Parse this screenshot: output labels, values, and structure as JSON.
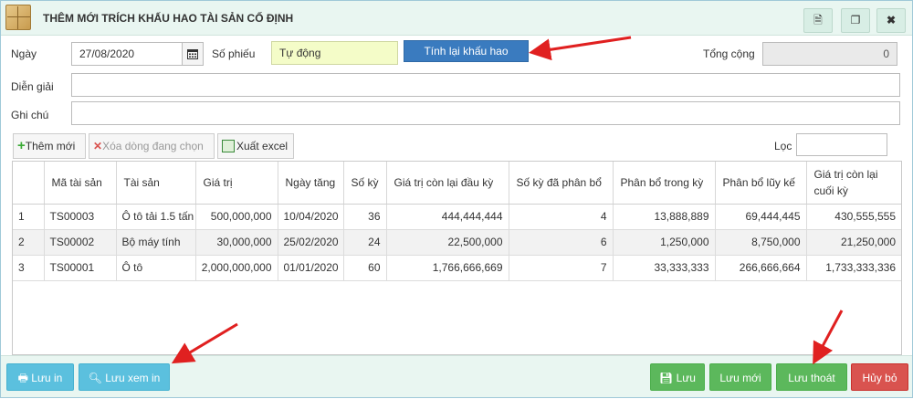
{
  "window": {
    "title": "THÊM MỚI TRÍCH KHẤU HAO TÀI SẢN CỐ ĐỊNH",
    "buttons": {
      "doc_icon": "document-icon",
      "copy_icon": "copy-icon",
      "close_icon": "close-icon"
    }
  },
  "form": {
    "date_label": "Ngày",
    "date_value": "27/08/2020",
    "voucher_label": "Số phiếu",
    "voucher_value": "Tự động",
    "recalc_button": "Tính lại khấu hao",
    "total_label": "Tổng cộng",
    "total_value": "0",
    "description_label": "Diễn giải",
    "description_value": "",
    "note_label": "Ghi chú",
    "note_value": ""
  },
  "toolbar": {
    "add_label": "Thêm mới",
    "delete_label": "Xóa dòng đang chọn",
    "export_label": "Xuất excel",
    "filter_label": "Lọc",
    "filter_value": ""
  },
  "table": {
    "headers": [
      "",
      "Mã tài sản",
      "Tài sản",
      "Giá trị",
      "Ngày tăng",
      "Số kỳ",
      "Giá trị còn lại đầu kỳ",
      "Số kỳ đã phân bổ",
      "Phân bổ trong kỳ",
      "Phân bổ lũy kế",
      "Giá trị còn lại cuối kỳ"
    ],
    "rows": [
      [
        "1",
        "TS00003",
        "Ô tô tải 1.5 tấn",
        "500,000,000",
        "10/04/2020",
        "36",
        "444,444,444",
        "4",
        "13,888,889",
        "69,444,445",
        "430,555,555"
      ],
      [
        "2",
        "TS00002",
        "Bộ máy tính",
        "30,000,000",
        "25/02/2020",
        "24",
        "22,500,000",
        "6",
        "1,250,000",
        "8,750,000",
        "21,250,000"
      ],
      [
        "3",
        "TS00001",
        "Ô tô",
        "2,000,000,000",
        "01/01/2020",
        "60",
        "1,766,666,669",
        "7",
        "33,333,333",
        "266,666,664",
        "1,733,333,336"
      ]
    ]
  },
  "footer": {
    "print_label": "Lưu in",
    "print_preview_label": "Lưu xem in",
    "save_label": "Lưu",
    "save_new_label": "Lưu mới",
    "save_exit_label": "Lưu thoát",
    "cancel_label": "Hủy bỏ"
  },
  "colors": {
    "accent_blue": "#3a7bbf",
    "teal_button": "#5bc0de",
    "green_button": "#5cb85c",
    "red_button": "#d9534f",
    "annotation_arrow": "#e02020"
  }
}
